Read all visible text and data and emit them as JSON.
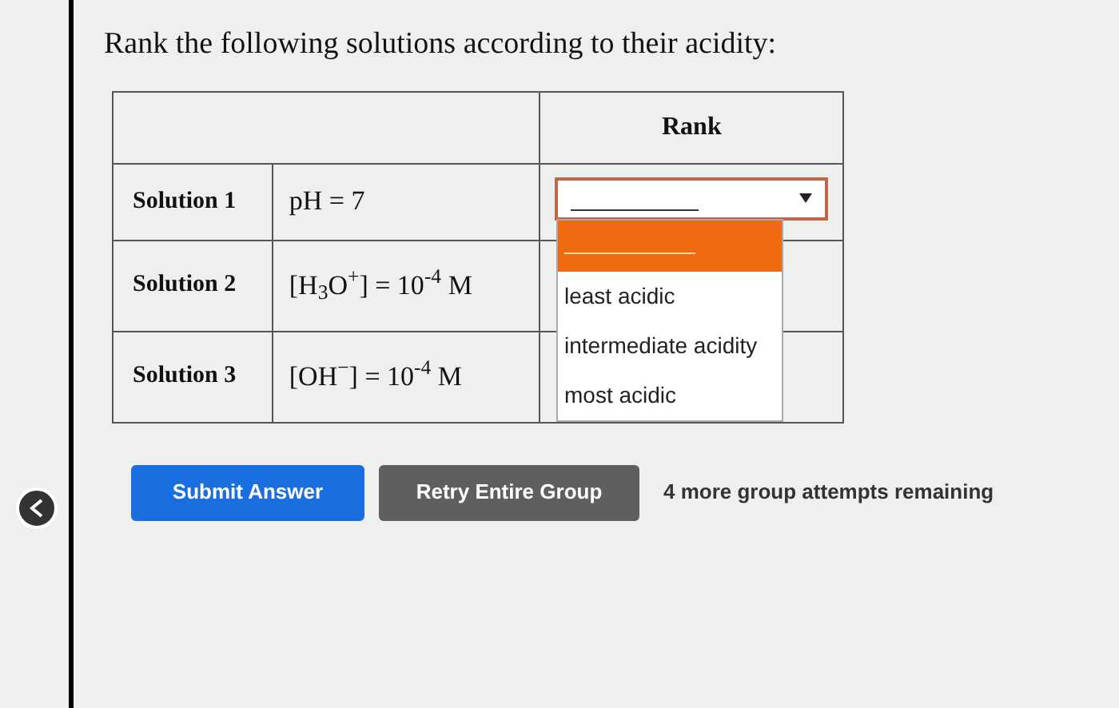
{
  "question": "Rank the following solutions according to their acidity:",
  "table": {
    "header": "Rank",
    "rows": [
      {
        "label": "Solution 1",
        "formula": "pH = 7",
        "has_dropdown": true
      },
      {
        "label": "Solution 2",
        "formula": "[H$_{3}$O$^{+}$] = 10$^{-4}$ M",
        "has_dropdown": false
      },
      {
        "label": "Solution 3",
        "formula": "[OH$^{−}$] = 10$^{-4}$ M",
        "has_dropdown": false
      }
    ]
  },
  "dropdown": {
    "expanded": true,
    "options": [
      {
        "kind": "blank",
        "selected": true
      },
      {
        "kind": "text",
        "label": "least acidic",
        "selected": false
      },
      {
        "kind": "text",
        "label": "intermediate acidity",
        "selected": false
      },
      {
        "kind": "text",
        "label": "most acidic",
        "selected": false
      }
    ]
  },
  "buttons": [
    {
      "label": "Submit Answer",
      "kind": "primary"
    },
    {
      "label": "Retry Entire Group",
      "kind": "secondary"
    }
  ],
  "attempts": "4 more group attempts remaining"
}
